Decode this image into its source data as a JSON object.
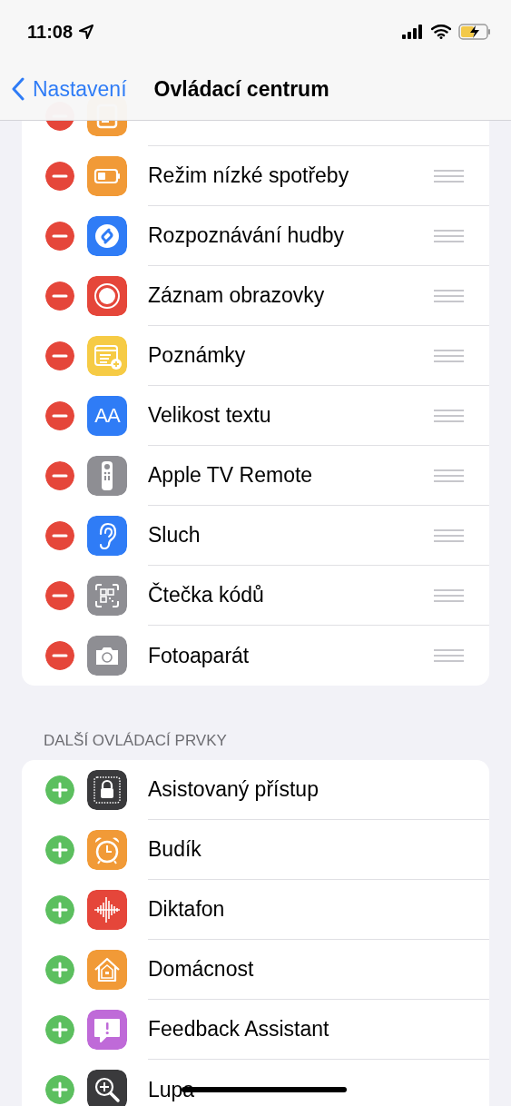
{
  "status_bar": {
    "time": "11:08"
  },
  "nav": {
    "back": "Nastavení",
    "title": "Ovládací centrum"
  },
  "sections": [
    {
      "items": [
        {
          "kind": "remove"
        },
        {
          "kind": "remove",
          "label": "Režim nízké spotřeby"
        },
        {
          "kind": "remove",
          "label": "Rozpoznávání hudby"
        },
        {
          "kind": "remove",
          "label": "Záznam obrazovky"
        },
        {
          "kind": "remove",
          "label": "Poznámky"
        },
        {
          "kind": "remove",
          "label": "Velikost textu",
          "icon_label": "AA"
        },
        {
          "kind": "remove",
          "label": "Apple TV Remote"
        },
        {
          "kind": "remove",
          "label": "Sluch"
        },
        {
          "kind": "remove",
          "label": "Čtečka kódů"
        },
        {
          "kind": "remove",
          "label": "Fotoaparát"
        }
      ]
    },
    {
      "header": "DALŠÍ OVLÁDACÍ PRVKY",
      "items": [
        {
          "kind": "add",
          "label": "Asistovaný přístup"
        },
        {
          "kind": "add",
          "label": "Budík"
        },
        {
          "kind": "add",
          "label": "Diktafon"
        },
        {
          "kind": "add",
          "label": "Domácnost"
        },
        {
          "kind": "add",
          "label": "Feedback Assistant"
        },
        {
          "kind": "add",
          "label": "Lupa"
        }
      ]
    }
  ]
}
